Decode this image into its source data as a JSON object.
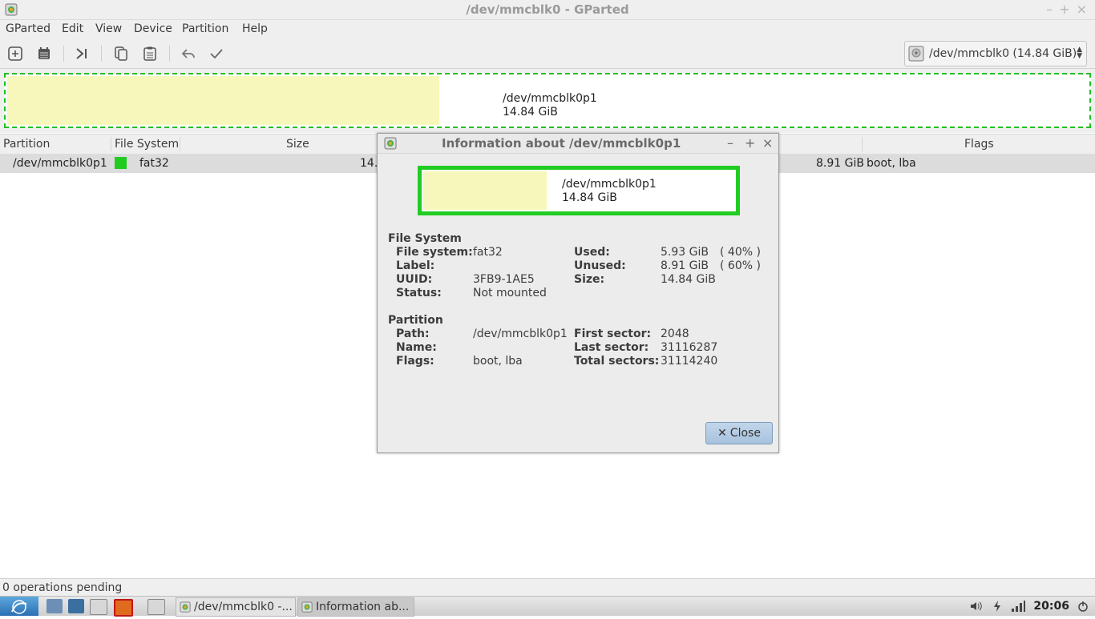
{
  "window": {
    "title": "/dev/mmcblk0 - GParted",
    "controls": {
      "minimize": "–",
      "maximize": "+",
      "close": "×"
    }
  },
  "menubar": [
    "GParted",
    "Edit",
    "View",
    "Device",
    "Partition",
    "Help"
  ],
  "toolbar": {
    "buttons": [
      "new-partition",
      "delete-partition",
      "resize-move",
      "copy",
      "paste",
      "undo",
      "apply"
    ],
    "device_selector": "/dev/mmcblk0   (14.84 GiB)"
  },
  "disk_visual": {
    "partition_name": "/dev/mmcblk0p1",
    "partition_size": "14.84 GiB",
    "used_fraction": 0.4,
    "used_color": "#f7f7bb",
    "border_color": "#22c022"
  },
  "table": {
    "columns": [
      "Partition",
      "File System",
      "Size",
      "Flags"
    ],
    "rows": [
      {
        "partition": "/dev/mmcblk0p1",
        "fs": "fat32",
        "size": "14.8",
        "unused": "8.91 GiB",
        "flags": "boot, lba",
        "fs_color": "#21cc21"
      }
    ]
  },
  "status": "0 operations pending",
  "dialog": {
    "title": "Information about /dev/mmcblk0p1",
    "bar": {
      "name": "/dev/mmcblk0p1",
      "size": "14.84 GiB",
      "used_fraction": 0.4
    },
    "filesystem_heading": "File System",
    "fs_labels": {
      "fs": "File system:",
      "label": "Label:",
      "uuid": "UUID:",
      "status": "Status:"
    },
    "fs_values": {
      "fs": "fat32",
      "label": "",
      "uuid": "3FB9-1AE5",
      "status": "Not mounted"
    },
    "usage_labels": {
      "used": "Used:",
      "unused": "Unused:",
      "size": "Size:"
    },
    "usage_values": {
      "used": "5.93 GiB",
      "used_pct": "( 40% )",
      "unused": "8.91 GiB",
      "unused_pct": "( 60% )",
      "size": "14.84 GiB"
    },
    "partition_heading": "Partition",
    "part_labels": {
      "path": "Path:",
      "name": "Name:",
      "flags": "Flags:"
    },
    "part_values": {
      "path": "/dev/mmcblk0p1",
      "name": "",
      "flags": "boot, lba"
    },
    "sector_labels": {
      "first": "First sector:",
      "last": "Last sector:",
      "total": "Total sectors:"
    },
    "sector_values": {
      "first": "2048",
      "last": "31116287",
      "total": "31114240"
    },
    "close_label": "Close"
  },
  "taskbar": {
    "tasks": [
      "/dev/mmcblk0 -...",
      "Information ab..."
    ],
    "clock": "20:06"
  }
}
